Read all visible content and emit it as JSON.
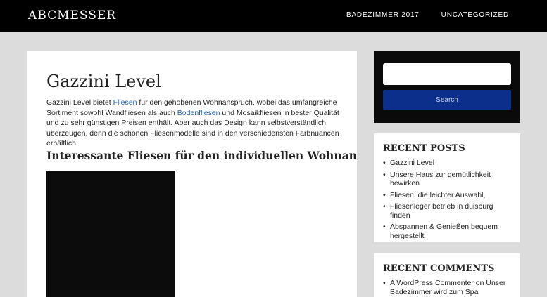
{
  "header": {
    "site_title": "ABCMESSER",
    "nav": [
      "BADEZIMMER 2017",
      "UNCATEGORIZED"
    ]
  },
  "post": {
    "title": "Gazzini Level",
    "p_intro": "Gazzini Level bietet ",
    "link1": "Fliesen",
    "p_mid1": " für den gehobenen Wohnanspruch, wobei das umfangreiche Sortiment sowohl Wandfliesen als auch ",
    "link2": "Bodenfliesen",
    "p_end": " und Mosaikfliesen in bester Qualität und zu sehr günstigen Preisen enthält. Aber auch das Design kann selbstverständlich überzeugen, denn die schönen Fliesenmodelle sind in den verschiedensten Farbnuancen erhältlich.",
    "subheading": "Interessante Fliesen für den individuellen Wohnanspruch"
  },
  "search": {
    "value": "",
    "button_label": "Search"
  },
  "recent_posts": {
    "heading": "RECENT POSTS",
    "items": [
      "Gazzini Level",
      "Unsere Haus zur gemütlichkeit bewirken",
      "Fliesen, die leichter Auswahl,",
      "Fliesenleger betrieb in duisburg finden",
      "Abspannen & Genießen bequem hergestellt"
    ]
  },
  "recent_comments": {
    "heading": "RECENT COMMENTS",
    "items": [
      {
        "author": "A WordPress Commenter",
        "on": " on ",
        "post": "Unser Badezimmer wird zum Spa"
      }
    ]
  },
  "colors": {
    "header_bg": "#000000",
    "page_bg": "#dcdcdc",
    "link": "#1a5fb4",
    "search_button": "#0b2f8a"
  }
}
